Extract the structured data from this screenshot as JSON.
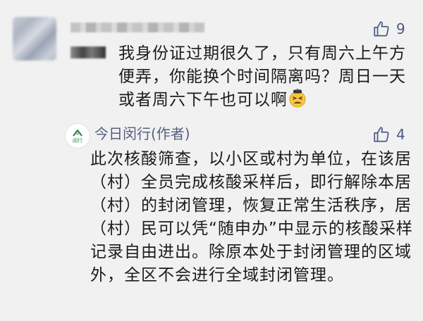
{
  "comment": {
    "like_count": "9",
    "text": "我身份证过期很久了，只有周六上午方便弄，你能换个时间隔离吗？周日一天或者周六下午也可以啊",
    "emoji": "tired-face-emoji"
  },
  "reply": {
    "author": "今日闵行(作者)",
    "avatar_label": "闵行",
    "like_count": "4",
    "text": "此次核酸筛查，以小区或村为单位，在该居（村）全员完成核酸采样后，即行解除本居（村）的封闭管理，恢复正常生活秩序，居（村）民可以凭“随申办”中显示的核酸采样记录自由进出。除原本处于封闭管理的区域外，全区不会进行全域封闭管理。"
  },
  "colors": {
    "background": "#f1f1f1",
    "link_blue": "#4a5b84",
    "brand_green": "#2e7d4f"
  }
}
